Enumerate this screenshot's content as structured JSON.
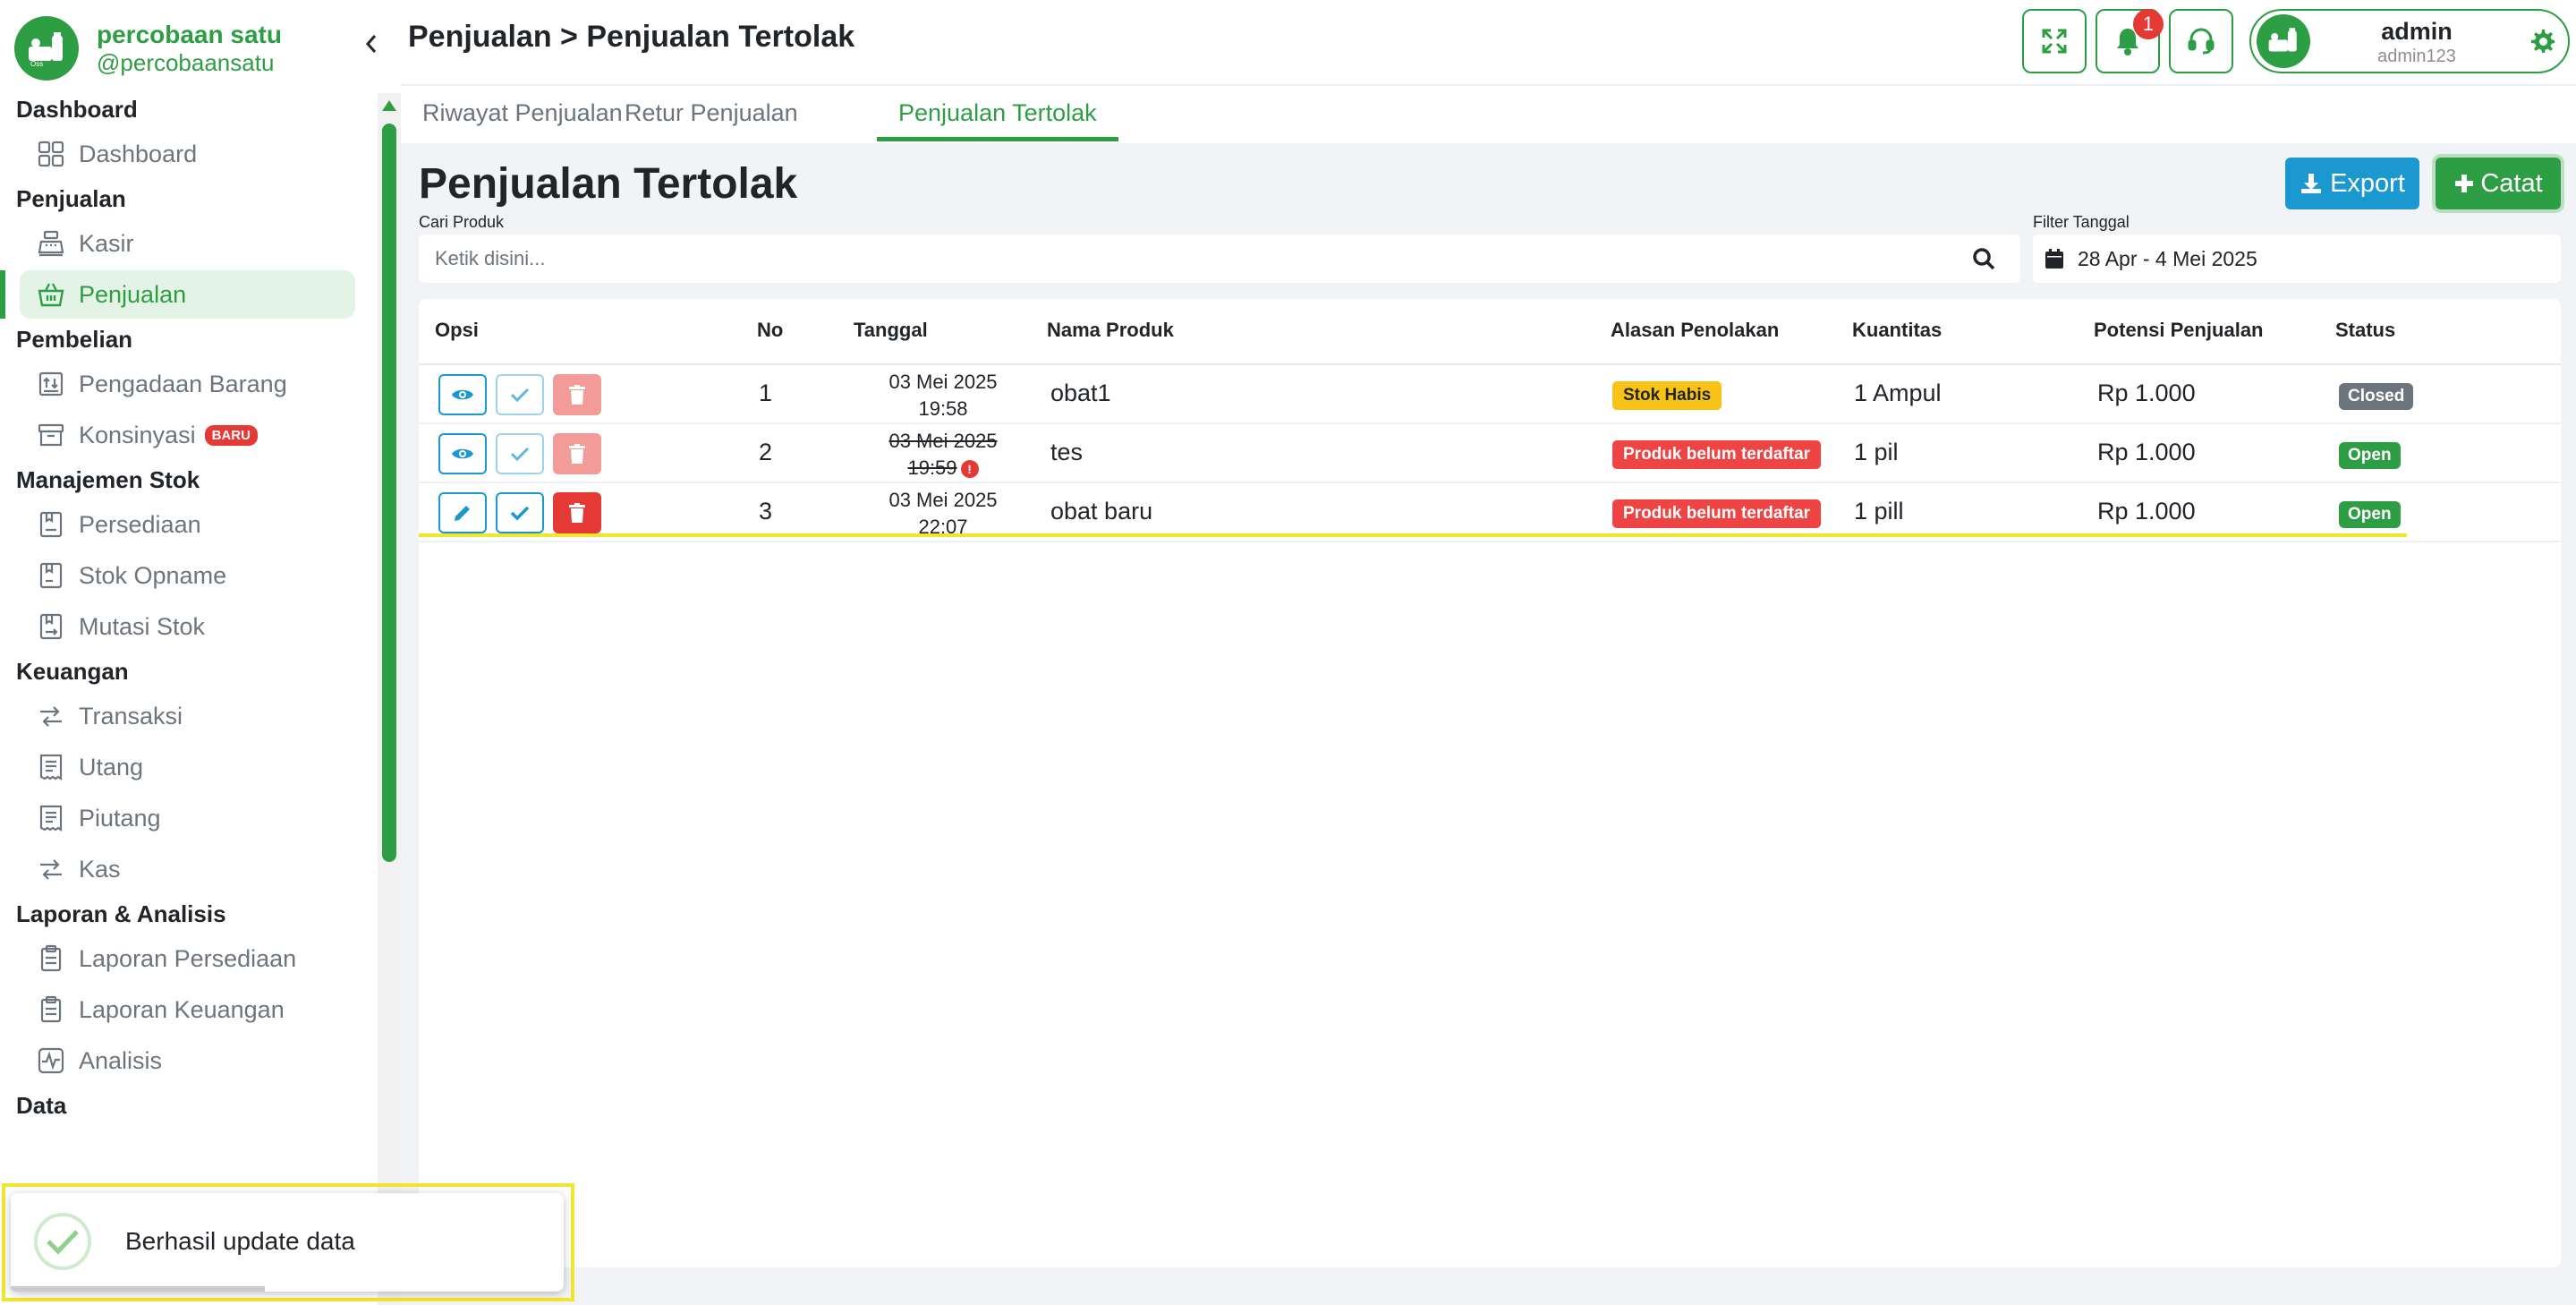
{
  "sidebar": {
    "brand_name": "percobaan satu",
    "brand_handle": "@percobaansatu",
    "groups": [
      {
        "title": "Dashboard",
        "items": [
          {
            "label": "Dashboard",
            "icon": "grid-icon"
          }
        ]
      },
      {
        "title": "Penjualan",
        "items": [
          {
            "label": "Kasir",
            "icon": "cash-register-icon"
          },
          {
            "label": "Penjualan",
            "icon": "basket-icon",
            "active": true
          }
        ]
      },
      {
        "title": "Pembelian",
        "items": [
          {
            "label": "Pengadaan Barang",
            "icon": "procurement-icon"
          },
          {
            "label": "Konsinyasi",
            "icon": "archive-icon",
            "badge": "BARU"
          }
        ]
      },
      {
        "title": "Manajemen Stok",
        "items": [
          {
            "label": "Persediaan",
            "icon": "inventory-icon"
          },
          {
            "label": "Stok Opname",
            "icon": "stock-opname-icon"
          },
          {
            "label": "Mutasi Stok",
            "icon": "stock-mutation-icon"
          }
        ]
      },
      {
        "title": "Keuangan",
        "items": [
          {
            "label": "Transaksi",
            "icon": "exchange-icon"
          },
          {
            "label": "Utang",
            "icon": "receipt-icon"
          },
          {
            "label": "Piutang",
            "icon": "receipt-icon"
          },
          {
            "label": "Kas",
            "icon": "exchange-icon"
          }
        ]
      },
      {
        "title": "Laporan & Analisis",
        "items": [
          {
            "label": "Laporan Persediaan",
            "icon": "clipboard-icon"
          },
          {
            "label": "Laporan Keuangan",
            "icon": "clipboard-icon"
          },
          {
            "label": "Analisis",
            "icon": "pulse-icon"
          }
        ]
      },
      {
        "title": "Data",
        "items": []
      }
    ]
  },
  "header": {
    "breadcrumb": "Penjualan > Penjualan Tertolak",
    "notification_count": "1",
    "user_name": "admin",
    "user_id": "admin123"
  },
  "tabs": [
    {
      "label": "Riwayat Penjualan",
      "active": false
    },
    {
      "label": "Retur Penjualan",
      "active": false
    },
    {
      "label": "Penjualan Tertolak",
      "active": true
    }
  ],
  "main": {
    "title": "Penjualan Tertolak",
    "export_label": "Export",
    "catat_label": "Catat",
    "search_label": "Cari Produk",
    "search_placeholder": "Ketik disini...",
    "date_filter_label": "Filter Tanggal",
    "date_filter_value": "28 Apr - 4 Mei 2025"
  },
  "table": {
    "columns": [
      "Opsi",
      "No",
      "Tanggal",
      "Nama Produk",
      "Alasan Penolakan",
      "Kuantitas",
      "Potensi Penjualan",
      "Status"
    ],
    "rows": [
      {
        "no": "1",
        "date": "03 Mei 2025",
        "time": "19:58",
        "product": "obat1",
        "reason": "Stok Habis",
        "reason_type": "warning",
        "qty": "1 Ampul",
        "potential": "Rp 1.000",
        "status": "Closed",
        "status_type": "closed",
        "first_action": "view",
        "actions_faded": true,
        "date_struck": false
      },
      {
        "no": "2",
        "date": "03 Mei 2025",
        "time": "19:59",
        "product": "tes",
        "reason": "Produk belum terdaftar",
        "reason_type": "danger",
        "qty": "1 pil",
        "potential": "Rp 1.000",
        "status": "Open",
        "status_type": "open",
        "first_action": "view",
        "actions_faded": true,
        "date_struck": true
      },
      {
        "no": "3",
        "date": "03 Mei 2025",
        "time": "22:07",
        "product": "obat baru",
        "reason": "Produk belum terdaftar",
        "reason_type": "danger",
        "qty": "1 pill",
        "potential": "Rp 1.000",
        "status": "Open",
        "status_type": "open",
        "first_action": "edit",
        "actions_faded": false,
        "date_struck": false
      }
    ]
  },
  "toast": {
    "message": "Berhasil update data",
    "progress": 0.46
  },
  "colors": {
    "brand_green": "#2e9e44",
    "export_blue": "#1a98cf",
    "danger_red": "#ef4444",
    "warning_yellow": "#f7c317",
    "highlight_yellow": "#f2e52e"
  }
}
